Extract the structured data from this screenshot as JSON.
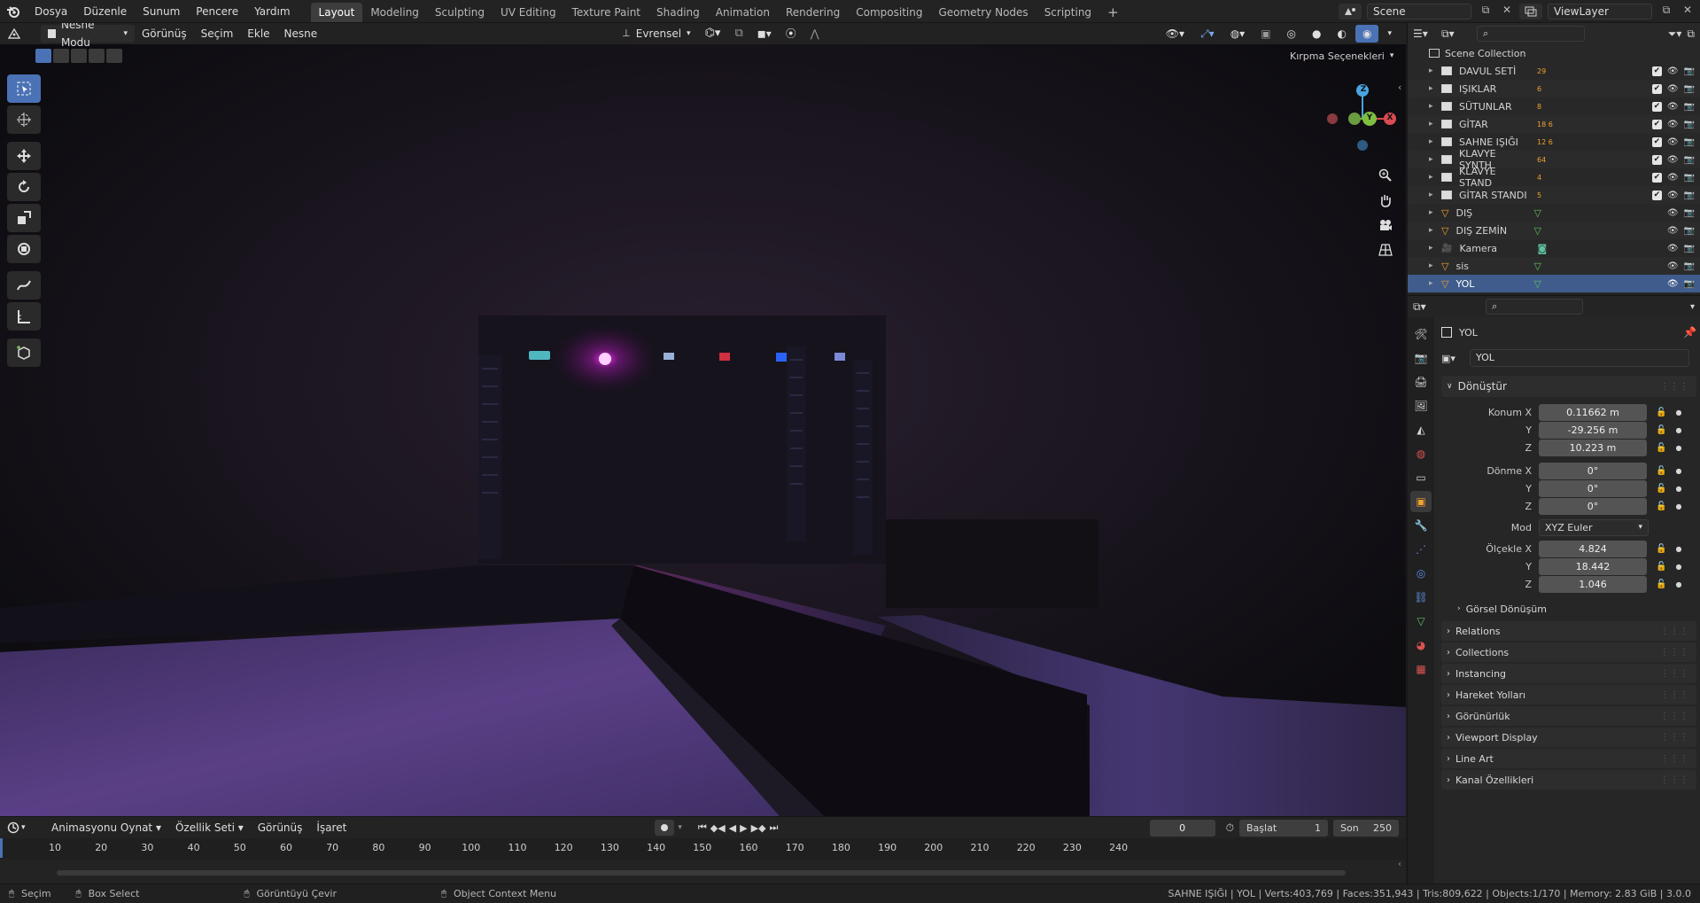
{
  "topbar": {
    "menus": [
      "Dosya",
      "Düzenle",
      "Sunum",
      "Pencere",
      "Yardım"
    ],
    "workspaces": [
      "Layout",
      "Modeling",
      "Sculpting",
      "UV Editing",
      "Texture Paint",
      "Shading",
      "Animation",
      "Rendering",
      "Compositing",
      "Geometry Nodes",
      "Scripting"
    ],
    "active_workspace": "Layout",
    "scene": "Scene",
    "view_layer": "ViewLayer"
  },
  "viewport": {
    "mode": "Nesne Modu",
    "menus": [
      "Görünüş",
      "Seçim",
      "Ekle",
      "Nesne"
    ],
    "orientation": "Evrensel",
    "clipping": "Kırpma Seçenekleri",
    "gizmo_axes": {
      "x": "X",
      "y": "Y",
      "z": "Z"
    }
  },
  "outliner": {
    "root": "Scene Collection",
    "items": [
      {
        "name": "DAVUL SETİ",
        "badge": "29",
        "type": "collection",
        "checked": true
      },
      {
        "name": "IŞIKLAR",
        "badge": "6",
        "type": "collection",
        "checked": true
      },
      {
        "name": "SÜTUNLAR",
        "badge": "8",
        "type": "collection",
        "checked": true
      },
      {
        "name": "GİTAR",
        "badge": "18 6",
        "type": "collection",
        "checked": true
      },
      {
        "name": "SAHNE IŞIĞI",
        "badge": "12 6",
        "type": "collection",
        "checked": true
      },
      {
        "name": "KLAVYE SYNTH",
        "badge": "64",
        "type": "collection",
        "checked": true
      },
      {
        "name": "KLAVYE STAND",
        "badge": "4",
        "type": "collection",
        "checked": true
      },
      {
        "name": "GİTAR STANDI",
        "badge": "5",
        "type": "collection",
        "checked": true
      },
      {
        "name": "DIŞ",
        "badge": "",
        "type": "mesh",
        "checked": false
      },
      {
        "name": "DIŞ ZEMİN",
        "badge": "",
        "type": "mesh",
        "checked": false
      },
      {
        "name": "Kamera",
        "badge": "",
        "type": "camera",
        "checked": false
      },
      {
        "name": "sis",
        "badge": "",
        "type": "mesh",
        "checked": false
      },
      {
        "name": "YOL",
        "badge": "",
        "type": "mesh",
        "checked": false,
        "selected": true
      }
    ]
  },
  "properties": {
    "object_name": "YOL",
    "object_field": "YOL",
    "transform_title": "Dönüştür",
    "location_label": "Konum X",
    "location": [
      "0.11662 m",
      "-29.256 m",
      "10.223 m"
    ],
    "rotation_label": "Dönme X",
    "rotation": [
      "0°",
      "0°",
      "0°"
    ],
    "mode_label": "Mod",
    "mode_value": "XYZ Euler",
    "scale_label": "Ölçekle X",
    "scale": [
      "4.824",
      "18.442",
      "1.046"
    ],
    "axis_y": "Y",
    "axis_z": "Z",
    "delta_transform": "Görsel Dönüşüm",
    "panels": [
      "Relations",
      "Collections",
      "Instancing",
      "Hareket Yolları",
      "Görünürlük",
      "Viewport Display",
      "Line Art",
      "Kanal Özellikleri"
    ]
  },
  "timeline": {
    "menus": [
      "Animasyonu Oynat",
      "Özellik Seti",
      "Görünüş",
      "İşaret"
    ],
    "current_frame": "0",
    "start_label": "Başlat",
    "start": "1",
    "end_label": "Son",
    "end": "250",
    "ticks": [
      "10",
      "20",
      "30",
      "40",
      "50",
      "60",
      "70",
      "80",
      "90",
      "100",
      "110",
      "120",
      "130",
      "140",
      "150",
      "160",
      "170",
      "180",
      "190",
      "200",
      "210",
      "220",
      "230",
      "240"
    ]
  },
  "statusbar": {
    "select": "Seçim",
    "box_select": "Box Select",
    "rotate_view": "Görüntüyü Çevir",
    "context_menu": "Object Context Menu",
    "stats": "SAHNE IŞIĞI | YOL | Verts:403,769 | Faces:351,943 | Tris:809,622 | Objects:1/170 | Memory: 2.83 GiB | 3.0.0"
  }
}
